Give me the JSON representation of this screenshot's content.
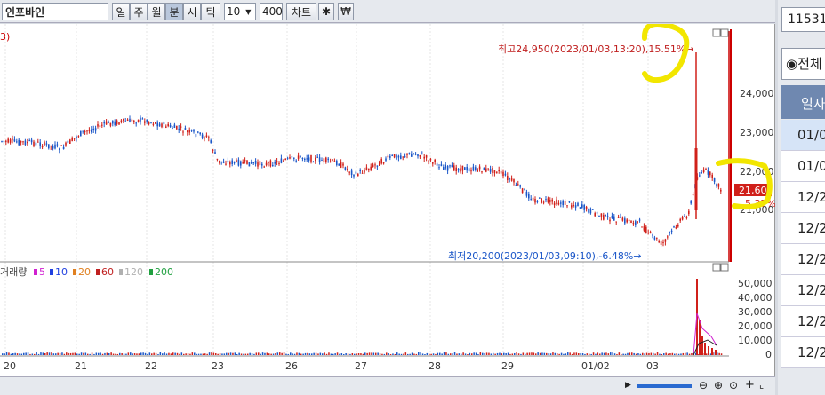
{
  "toolbar": {
    "stock_name": "인포바인",
    "period_buttons": [
      "일",
      "주",
      "월",
      "분",
      "시",
      "틱"
    ],
    "interval_value": "10",
    "count_value": "400",
    "chart_button": "차트",
    "active_period": "분"
  },
  "price_chart": {
    "title_fragment": "3)",
    "high_annotation": "최고24,950(2023/01/03,13:20),15.51%→",
    "low_annotation": "최저20,200(2023/01/03,09:10),-6.48%→",
    "current_price": "21,600",
    "current_change": "5.37%",
    "y_ticks": [
      "24,000",
      "23,000",
      "22,000",
      "21,000"
    ]
  },
  "volume_chart": {
    "legend_title": "거래량",
    "legend_items": [
      {
        "label": "5",
        "color": "#d020d0"
      },
      {
        "label": "10",
        "color": "#2040e0"
      },
      {
        "label": "20",
        "color": "#e08020"
      },
      {
        "label": "60",
        "color": "#c02020"
      },
      {
        "label": "120",
        "color": "#b0b0b0"
      },
      {
        "label": "200",
        "color": "#20a040"
      }
    ],
    "y_ticks": [
      "50,000",
      "40,000",
      "30,000",
      "20,000",
      "10,000",
      "0"
    ]
  },
  "x_axis": {
    "labels": [
      "20",
      "21",
      "22",
      "23",
      "26",
      "27",
      "28",
      "29",
      "01/02",
      "03"
    ]
  },
  "right_panel": {
    "code_value": "11531",
    "radio_label": "◉전체",
    "header": "일자",
    "rows": [
      "01/0",
      "01/0",
      "12/2",
      "12/2",
      "12/2",
      "12/2",
      "12/2",
      "12/2"
    ]
  },
  "colors": {
    "up": "#d0201a",
    "down": "#1a56c8",
    "highlight": "#f2e600"
  }
}
